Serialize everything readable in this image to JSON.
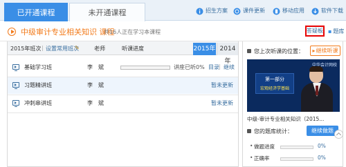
{
  "tabs": {
    "opened": "已开通课程",
    "not_opened": "未开通课程"
  },
  "top_links": [
    {
      "label": "招生方案",
      "icon": "info-icon"
    },
    {
      "label": "课件更新",
      "icon": "refresh-icon"
    },
    {
      "label": "移动应用",
      "icon": "mobile-icon"
    },
    {
      "label": "软件下载",
      "icon": "download-icon"
    }
  ],
  "course": {
    "title": "中级审计专业相关知识  课程",
    "learners": "共16人正在学习本课程",
    "qa_button": "答疑板",
    "bank_link": "题库"
  },
  "list": {
    "class_label": "2015年班次",
    "set_common_link": "设置常用班次",
    "col_teacher": "老师",
    "col_progress": "听课进度",
    "year_selected": "2015年",
    "year_other": "2014年",
    "rows": [
      {
        "name": "基础学习班",
        "teacher": "李　斌",
        "progress": 0,
        "progress_text": "讲座已听0%",
        "dir": "目录",
        "sep": "|",
        "cont": "继续"
      },
      {
        "name": "习题精讲班",
        "teacher": "李　斌",
        "status": "暂未更新"
      },
      {
        "name": "冲刺串讲班",
        "teacher": "李　斌",
        "status": "暂未更新"
      }
    ]
  },
  "last_lesson": {
    "title": "您上次听课的位置：",
    "button": "继续听课",
    "video": {
      "logo": "中华会计网校",
      "board_line1": "第一部分",
      "board_line2": "宏观经济学基础"
    },
    "caption": "中级-审计专业相关知识（2015..."
  },
  "question_bank": {
    "title": "您的题库统计：",
    "button": "继续做题",
    "stats": [
      {
        "label": "做题进度",
        "value": "0%",
        "progress": 0
      },
      {
        "label": "正确率",
        "value": "0%",
        "progress": 0
      }
    ]
  },
  "colors": {
    "accent": "#3a8ee6",
    "orange": "#f27a1a",
    "highlight_red": "#e60000"
  }
}
